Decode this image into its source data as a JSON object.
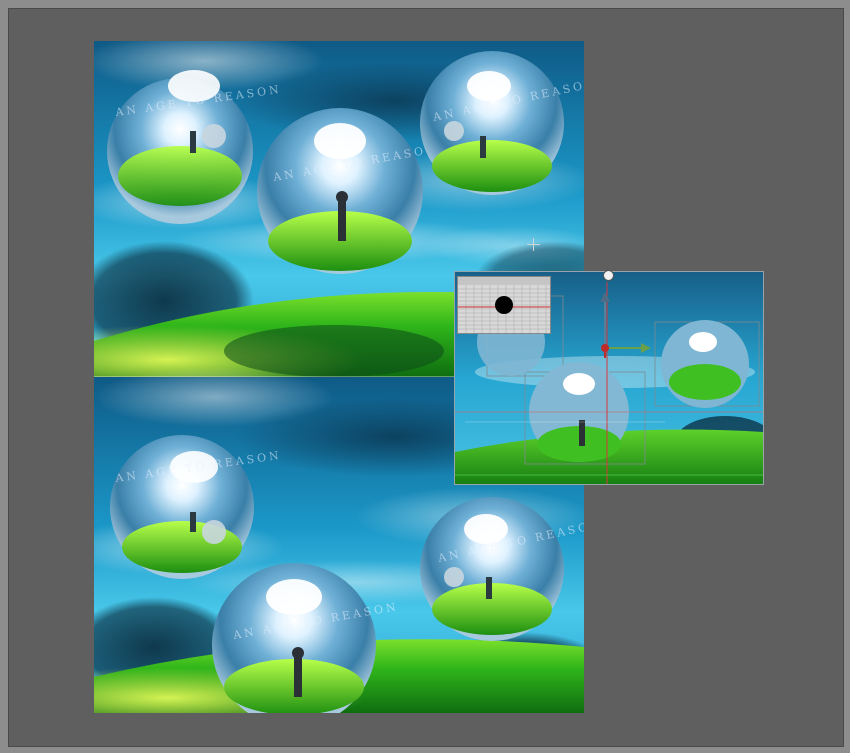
{
  "artwork": {
    "sphere_text": "AN AGE TO REASON",
    "colors": {
      "sky_top": "#0f5a86",
      "sky_mid": "#1b98c8",
      "sky_light": "#49c8ea",
      "grass": "#2fb51a",
      "grass_light": "#c6f24a",
      "background": "#5f5f5f",
      "frame": "#8d8d8d"
    }
  },
  "preview": {
    "close_glyph": "×"
  },
  "icons": {
    "crosshair": "crosshair-cursor-icon",
    "close": "close-icon",
    "move_gizmo": "move-gizmo-icon"
  }
}
